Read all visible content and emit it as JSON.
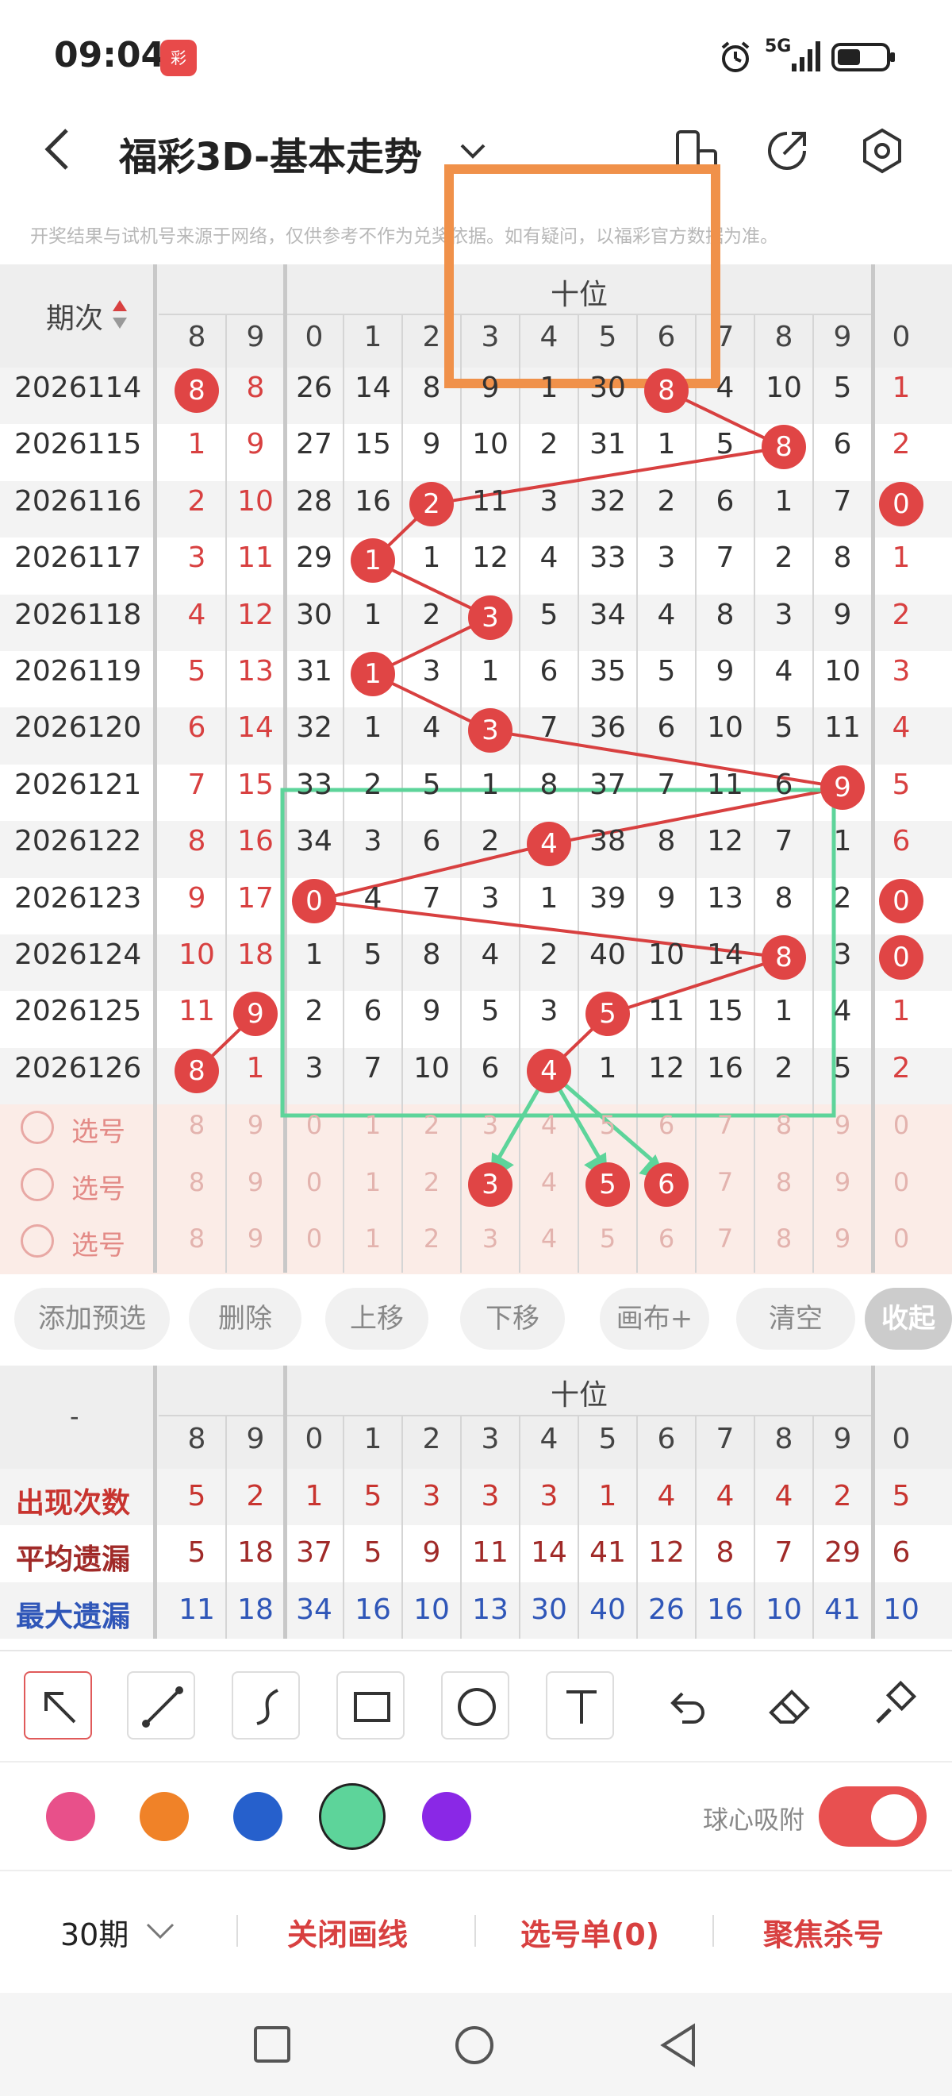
{
  "status": {
    "time": "09:04",
    "app_badge": "彩",
    "network": "5G"
  },
  "header": {
    "title": "福彩3D-基本走势"
  },
  "notice": "开奖结果与试机号来源于网络，仅供参考不作为兑奖依据。如有疑问，以福彩官方数据为准。",
  "table": {
    "period_header": "期次",
    "group_title": "十位",
    "columns": [
      "8",
      "9",
      "0",
      "1",
      "2",
      "3",
      "4",
      "5",
      "6",
      "7",
      "8",
      "9",
      "0"
    ],
    "rows": [
      {
        "period": "2026114",
        "cells": [
          "8",
          "8",
          "26",
          "14",
          "8",
          "9",
          "1",
          "30",
          "8",
          "4",
          "10",
          "5",
          "1"
        ]
      },
      {
        "period": "2026115",
        "cells": [
          "1",
          "9",
          "27",
          "15",
          "9",
          "10",
          "2",
          "31",
          "1",
          "5",
          "8",
          "6",
          "2"
        ]
      },
      {
        "period": "2026116",
        "cells": [
          "2",
          "10",
          "28",
          "16",
          "2",
          "11",
          "3",
          "32",
          "2",
          "6",
          "1",
          "7",
          "0"
        ]
      },
      {
        "period": "2026117",
        "cells": [
          "3",
          "11",
          "29",
          "1",
          "1",
          "12",
          "4",
          "33",
          "3",
          "7",
          "2",
          "8",
          "1"
        ]
      },
      {
        "period": "2026118",
        "cells": [
          "4",
          "12",
          "30",
          "1",
          "2",
          "3",
          "5",
          "34",
          "4",
          "8",
          "3",
          "9",
          "2"
        ]
      },
      {
        "period": "2026119",
        "cells": [
          "5",
          "13",
          "31",
          "1",
          "3",
          "1",
          "6",
          "35",
          "5",
          "9",
          "4",
          "10",
          "3"
        ]
      },
      {
        "period": "2026120",
        "cells": [
          "6",
          "14",
          "32",
          "1",
          "4",
          "3",
          "7",
          "36",
          "6",
          "10",
          "5",
          "11",
          "4"
        ]
      },
      {
        "period": "2026121",
        "cells": [
          "7",
          "15",
          "33",
          "2",
          "5",
          "1",
          "8",
          "37",
          "7",
          "11",
          "6",
          "9",
          "5"
        ]
      },
      {
        "period": "2026122",
        "cells": [
          "8",
          "16",
          "34",
          "3",
          "6",
          "2",
          "4",
          "38",
          "8",
          "12",
          "7",
          "1",
          "6"
        ]
      },
      {
        "period": "2026123",
        "cells": [
          "9",
          "17",
          "0",
          "4",
          "7",
          "3",
          "1",
          "39",
          "9",
          "13",
          "8",
          "2",
          "0"
        ]
      },
      {
        "period": "2026124",
        "cells": [
          "10",
          "18",
          "1",
          "5",
          "8",
          "4",
          "2",
          "40",
          "10",
          "14",
          "8",
          "3",
          "0"
        ]
      },
      {
        "period": "2026125",
        "cells": [
          "11",
          "9",
          "2",
          "6",
          "9",
          "5",
          "3",
          "5",
          "11",
          "15",
          "1",
          "4",
          "1"
        ]
      },
      {
        "period": "2026126",
        "cells": [
          "8",
          "1",
          "3",
          "7",
          "10",
          "6",
          "4",
          "1",
          "12",
          "16",
          "2",
          "5",
          "2"
        ]
      }
    ],
    "balls": [
      [
        0,
        0
      ],
      [
        0,
        8
      ],
      [
        1,
        10
      ],
      [
        2,
        4
      ],
      [
        2,
        12
      ],
      [
        3,
        3
      ],
      [
        4,
        5
      ],
      [
        5,
        3
      ],
      [
        6,
        5
      ],
      [
        7,
        11
      ],
      [
        8,
        6
      ],
      [
        9,
        2
      ],
      [
        9,
        12
      ],
      [
        10,
        10
      ],
      [
        10,
        12
      ],
      [
        11,
        1
      ],
      [
        11,
        7
      ],
      [
        12,
        0
      ],
      [
        12,
        6
      ]
    ],
    "select_label": "选号",
    "select_rows": 3,
    "select_balls": [
      [
        1,
        5
      ],
      [
        1,
        7
      ],
      [
        1,
        8
      ]
    ]
  },
  "actions": [
    "添加预选",
    "删除",
    "上移",
    "下移",
    "画布+",
    "清空",
    "收起"
  ],
  "stats": {
    "dash": "-",
    "group_title": "十位",
    "columns": [
      "8",
      "9",
      "0",
      "1",
      "2",
      "3",
      "4",
      "5",
      "6",
      "7",
      "8",
      "9",
      "0"
    ],
    "rows": [
      {
        "label": "出现次数",
        "color": "#c8342f",
        "cells": [
          "5",
          "2",
          "1",
          "5",
          "3",
          "3",
          "3",
          "1",
          "4",
          "4",
          "4",
          "2",
          "5"
        ]
      },
      {
        "label": "平均遗漏",
        "color": "#a02a28",
        "cells": [
          "5",
          "18",
          "37",
          "5",
          "9",
          "11",
          "14",
          "41",
          "12",
          "8",
          "7",
          "29",
          "6"
        ]
      },
      {
        "label": "最大遗漏",
        "color": "#2f56b8",
        "cells": [
          "11",
          "18",
          "34",
          "16",
          "10",
          "13",
          "30",
          "40",
          "26",
          "16",
          "10",
          "41",
          "10"
        ]
      }
    ]
  },
  "tools": [
    "arrow-tool-icon",
    "line-tool-icon",
    "curve-tool-icon",
    "rect-tool-icon",
    "circle-tool-icon",
    "text-tool-icon",
    "undo-icon",
    "eraser-icon",
    "brush-icon"
  ],
  "colors": [
    "#e8508a",
    "#f08228",
    "#2660cc",
    "#5dd49a",
    "#8a28e6"
  ],
  "snap_label": "球心吸附",
  "bottom": {
    "period_select": "30期",
    "close_lines": "关闭画线",
    "selection": "选号单(0)",
    "focus": "聚焦杀号"
  }
}
